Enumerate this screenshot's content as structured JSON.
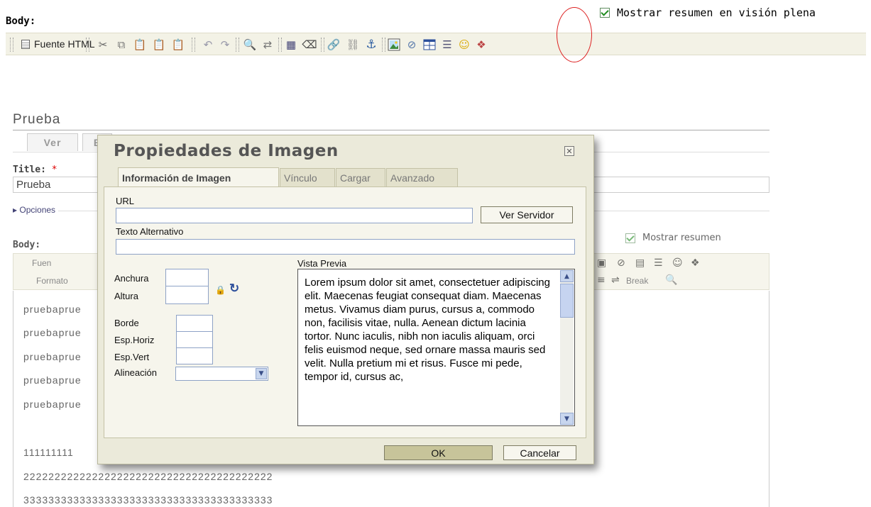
{
  "header": {
    "body_label": "Body:",
    "show_summary_label": "Mostrar resumen en visión plena",
    "show_summary_checked": true
  },
  "toolbar": {
    "source_label": "Fuente HTML",
    "icons": [
      "cut-icon",
      "copy-icon",
      "paste-icon",
      "paste-text-icon",
      "paste-word-icon",
      "undo-icon",
      "redo-icon",
      "find-icon",
      "replace-icon",
      "select-all-icon",
      "remove-format-icon",
      "link-icon",
      "unlink-icon",
      "anchor-icon",
      "image-icon",
      "flash-icon",
      "table-icon",
      "horizontal-rule-icon",
      "smiley-icon",
      "special-char-icon"
    ]
  },
  "page": {
    "title": "Prueba",
    "tabs": [
      "Ver",
      "E"
    ],
    "title_label": "Title:",
    "required_mark": "*",
    "title_value": "Prueba",
    "options_link": "▸ Opciones",
    "body_label": "Body:",
    "show_summary_label": "Mostrar resumen",
    "editor_toolbar": {
      "source_label": "Fuen",
      "format_label": "Formato",
      "break_label": "Break"
    },
    "editor_lines": [
      "pruebaprue",
      "pruebaprue",
      "pruebaprue",
      "pruebaprue",
      "pruebaprue",
      "111111111",
      "2222222222222222222222222222222222222222",
      "3333333333333333333333333333333333333333"
    ]
  },
  "dialog": {
    "title": "Propiedades de Imagen",
    "tabs": [
      "Información de Imagen",
      "Vínculo",
      "Cargar",
      "Avanzado"
    ],
    "active_tab": "Información de Imagen",
    "url_label": "URL",
    "url_value": "",
    "browse_button": "Ver Servidor",
    "alt_label": "Texto Alternativo",
    "alt_value": "",
    "width_label": "Anchura",
    "height_label": "Altura",
    "border_label": "Borde",
    "hspace_label": "Esp.Horiz",
    "vspace_label": "Esp.Vert",
    "align_label": "Alineación",
    "align_value": "",
    "preview_label": "Vista Previa",
    "preview_text": "Lorem ipsum dolor sit amet, consectetuer adipiscing elit. Maecenas feugiat consequat diam. Maecenas metus. Vivamus diam purus, cursus a, commodo non, facilisis vitae, nulla. Aenean dictum lacinia tortor. Nunc iaculis, nibh non iaculis aliquam, orci felis euismod neque, sed ornare massa mauris sed velit. Nulla pretium mi et risus. Fusce mi pede, tempor id, cursus ac,",
    "ok_button": "OK",
    "cancel_button": "Cancelar"
  },
  "colors": {
    "annotation": "#dd2222",
    "dialog_bg": "#ebeada",
    "toolbar_bg": "#f3f2e6",
    "button_bg": "#c7c49a"
  }
}
